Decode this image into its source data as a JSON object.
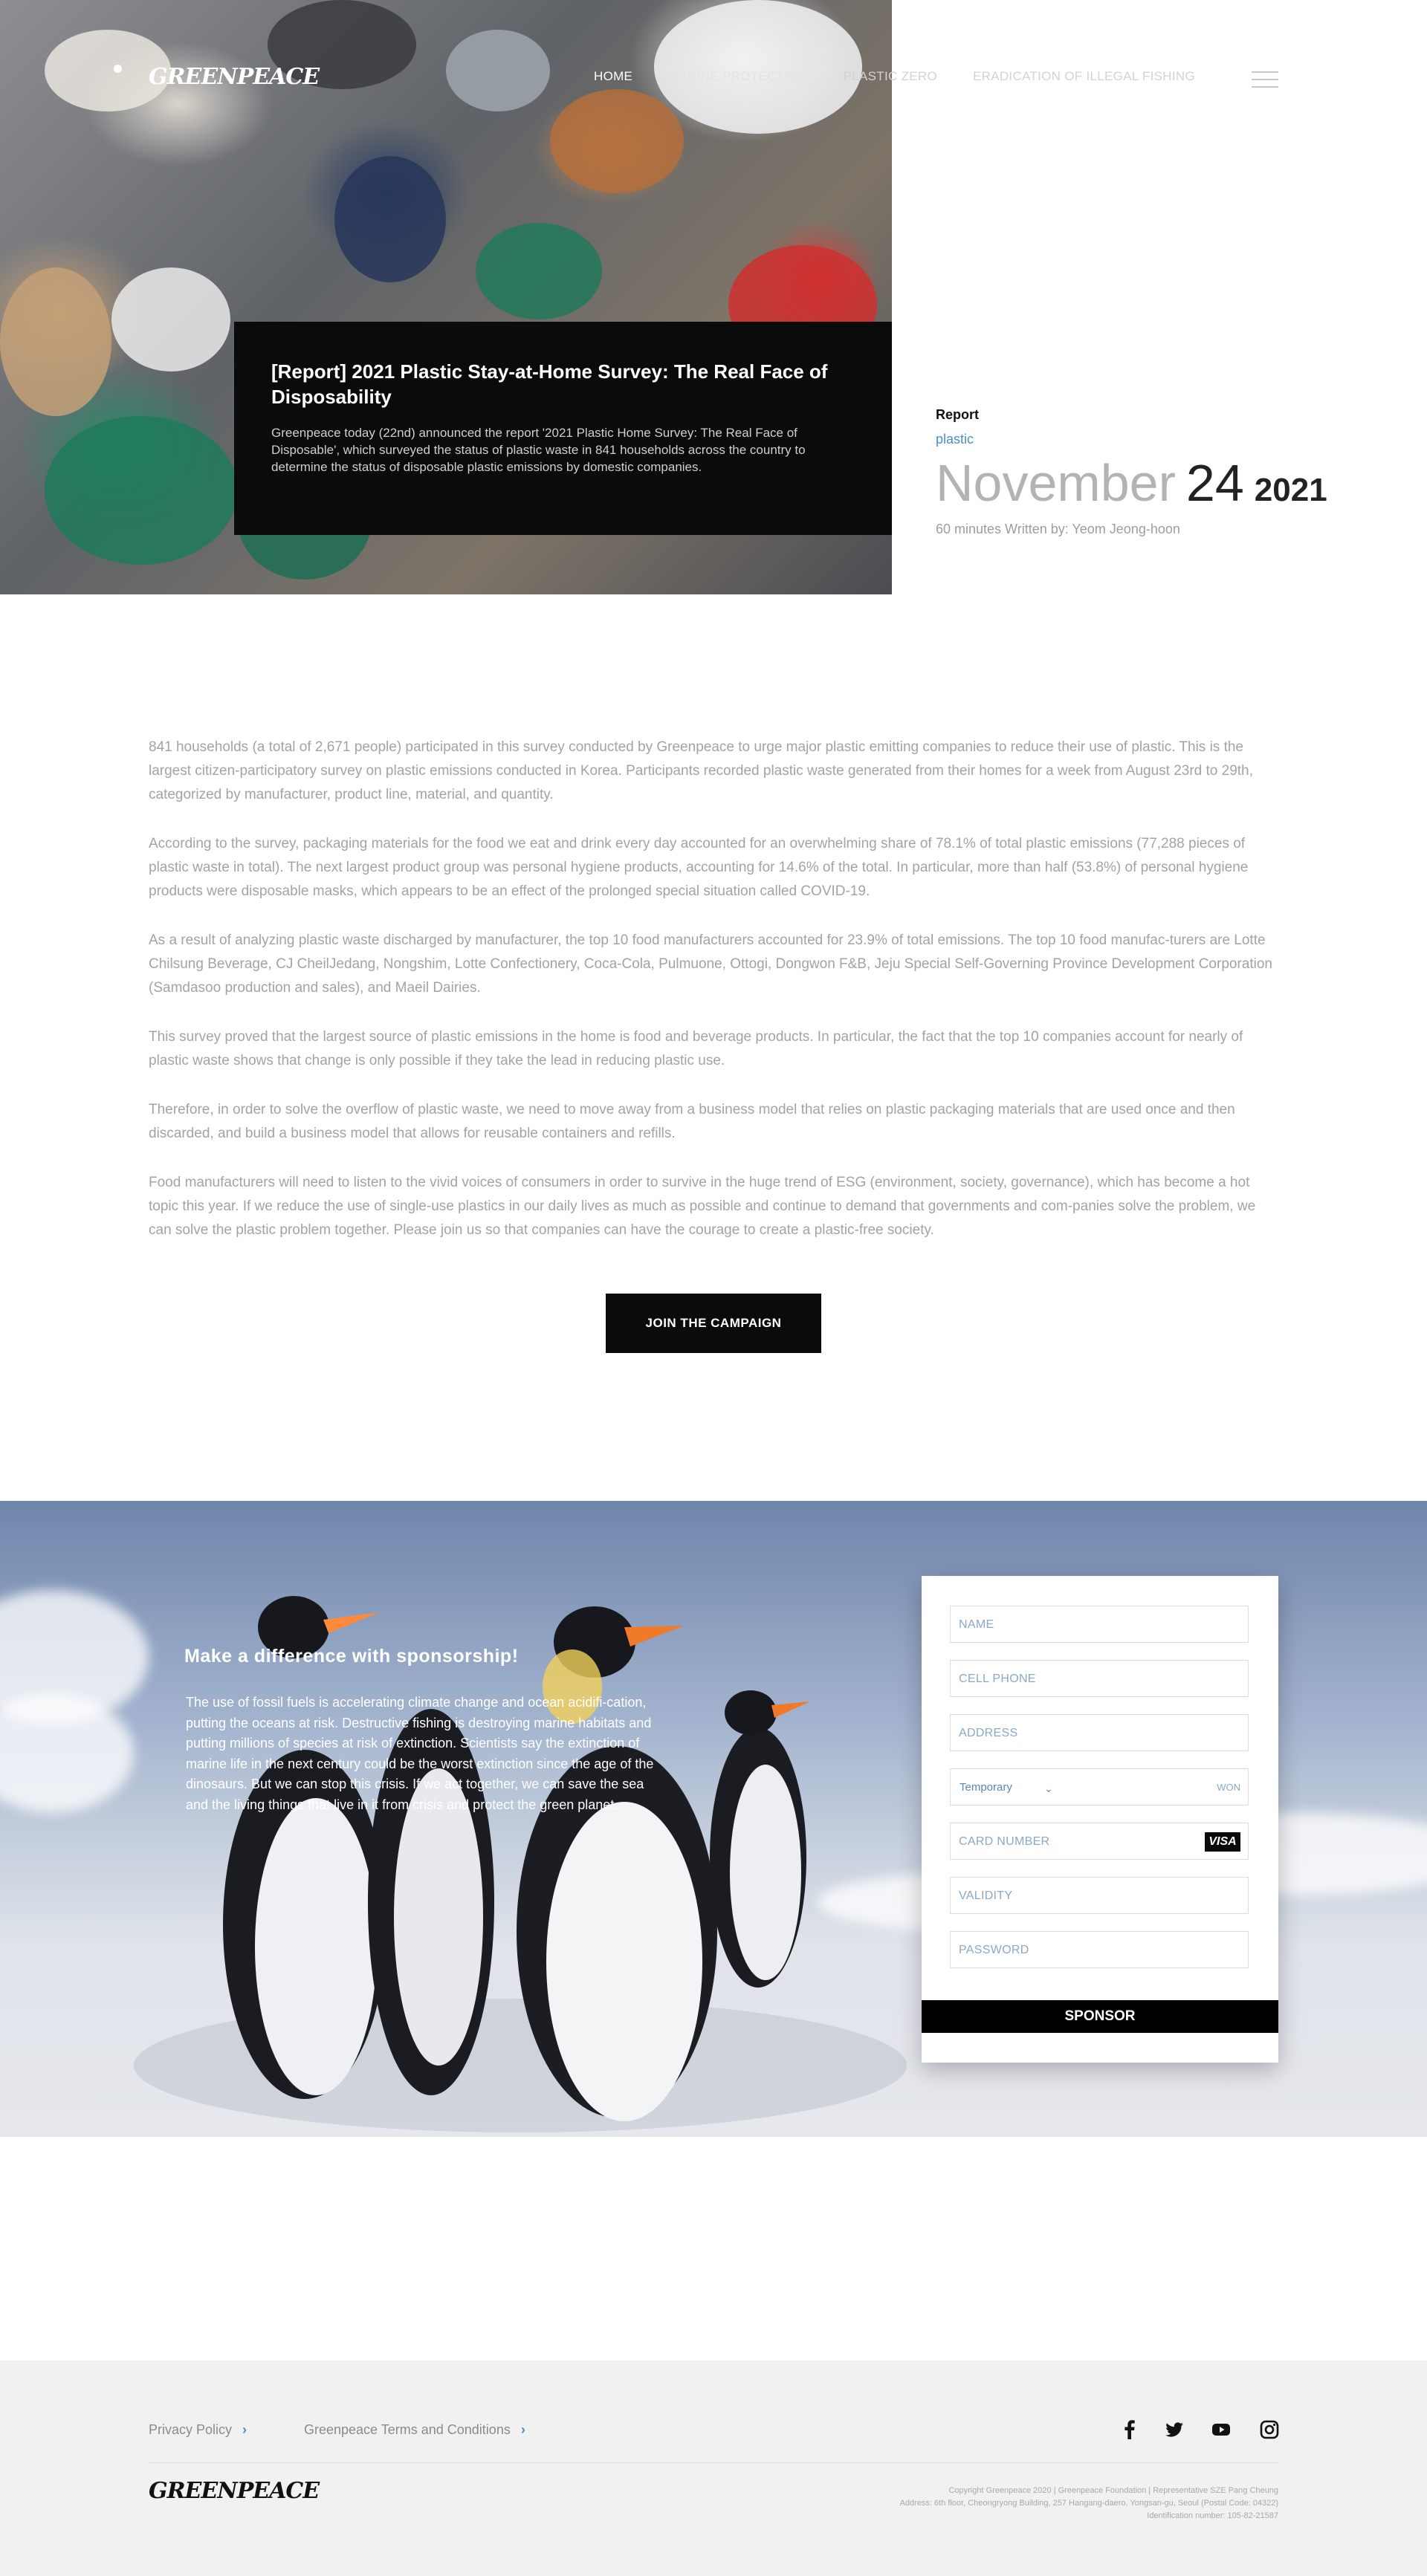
{
  "header": {
    "logo": "GREENPEACE",
    "nav": [
      "HOME",
      "MARINE PROTECTION",
      "PLASTIC ZERO",
      "ERADICATION OF ILLEGAL FISHING"
    ]
  },
  "hero": {
    "title": "[Report] 2021 Plastic Stay-at-Home Survey: The Real Face of Disposability",
    "summary": "Greenpeace today (22nd) announced the report '2021 Plastic Home Survey: The Real Face of Disposable', which surveyed the status of plastic waste in 841 households across the country to determine the status of disposable plastic emissions by domestic companies."
  },
  "meta": {
    "type": "Report",
    "tag": "plastic",
    "month": "November",
    "day": "24",
    "year": "2021",
    "read_info": "60 minutes Written by: Yeom Jeong-hoon"
  },
  "article": {
    "paragraphs": [
      "841 households (a total of 2,671 people) participated in this survey conducted by Greenpeace to urge major plastic emitting companies to reduce their use of plastic. This is the largest citizen-participatory survey on plastic emissions conducted in Korea. Participants recorded plastic waste generated from their homes for a week from August 23rd to 29th, categorized by manufacturer, product line, material, and quantity.",
      "According to the survey, packaging materials for the food we eat and drink every day accounted for an overwhelming share of 78.1% of total plastic emissions (77,288 pieces of plastic waste in total). The next largest product group was personal hygiene products, accounting for 14.6% of the total. In particular, more than half (53.8%) of personal hygiene products were disposable masks, which appears to be an effect of the prolonged special situation called COVID-19.",
      "As a result of analyzing plastic waste discharged by manufacturer, the top 10 food manufacturers accounted for 23.9% of total emissions. The top 10 food manufac-turers are Lotte Chilsung Beverage, CJ CheilJedang, Nongshim, Lotte Confectionery, Coca-Cola, Pulmuone, Ottogi, Dongwon F&B, Jeju Special Self-Governing Province Development Corporation (Samdasoo production and sales), and Maeil Dairies.",
      "This survey proved that the largest source of plastic emissions in the home is food and beverage products. In particular, the fact that the top 10 companies account for nearly of plastic waste shows that change is only possible if they take the lead in reducing plastic use.",
      "Therefore, in order to solve the overflow of plastic waste, we need to move away from a business model that relies on plastic packaging materials that are used once and then discarded, and build a business model that allows for reusable containers and refills.",
      "Food manufacturers will need to listen to the vivid voices of consumers in order to survive in the huge trend of ESG (environment, society, governance), which has become a hot topic this year. If we reduce the use of single-use plastics in our daily lives as much as possible and continue to demand that governments and com-panies solve the problem, we can solve the plastic problem together. Please join us so that companies can have the courage to create a plastic-free society."
    ],
    "cta": "JOIN THE CAMPAIGN"
  },
  "sponsor": {
    "title": "Make a difference with sponsorship!",
    "text": "The use of fossil fuels is accelerating climate change and ocean acidifi-cation, putting the oceans at risk. Destructive fishing is destroying marine habitats and putting millions of species at risk of extinction. Scientists say the extinction of marine life in the next century could be the worst extinction since the age of the dinosaurs. But we can stop this crisis. If we act together, we can save the sea and the living things that live in it from crisis and protect the green planet.",
    "form": {
      "name": "NAME",
      "phone": "CELL PHONE",
      "address": "ADDRESS",
      "type": "Temporary",
      "currency": "WON",
      "card": "CARD NUMBER",
      "card_brand": "VISA",
      "validity": "VALIDITY",
      "password": "PASSWORD",
      "submit": "SPONSOR"
    }
  },
  "footer": {
    "links": [
      "Privacy Policy",
      "Greenpeace Terms and Conditions"
    ],
    "logo": "GREENPEACE",
    "social": [
      "facebook-icon",
      "twitter-icon",
      "youtube-icon",
      "instagram-icon"
    ],
    "copyright": [
      "Copyright Greenpeace 2020 | Greenpeace Foundation | Representative SZE Pang Cheung",
      "Address: 6th floor, Cheongryong Building, 257 Hangang-daero, Yongsan-gu, Seoul (Postal Code: 04322)",
      "Identification number: 105-82-21587"
    ]
  }
}
